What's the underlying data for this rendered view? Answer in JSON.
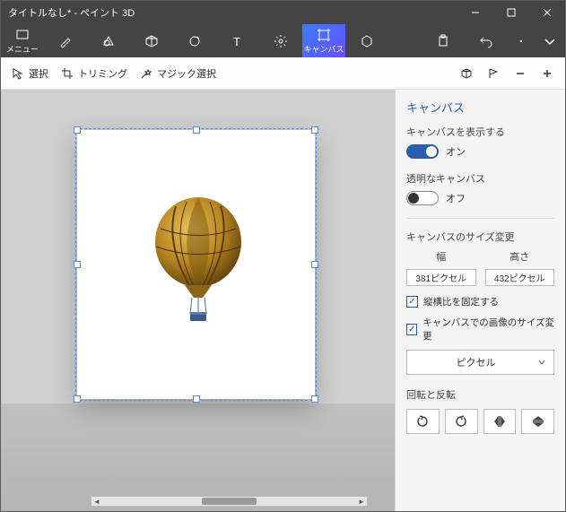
{
  "window": {
    "title": "タイトルなし* - ペイント 3D"
  },
  "toolbar": {
    "menu": "メニュー",
    "canvas": "キャンバス"
  },
  "subtoolbar": {
    "select": "選択",
    "trimming": "トリミング",
    "magic": "マジック選択"
  },
  "panel": {
    "title": "キャンバス",
    "show_canvas_label": "キャンバスを表示する",
    "show_canvas_state": "オン",
    "transparent_label": "透明なキャンバス",
    "transparent_state": "オフ",
    "resize_label": "キャンバスのサイズ変更",
    "width_label": "幅",
    "height_label": "高さ",
    "width_value": "381ピクセル",
    "height_value": "432ピクセル",
    "lock_aspect": "縦横比を固定する",
    "resize_image": "キャンバスでの画像のサイズ変更",
    "unit": "ピクセル",
    "rotate_label": "回転と反転"
  }
}
